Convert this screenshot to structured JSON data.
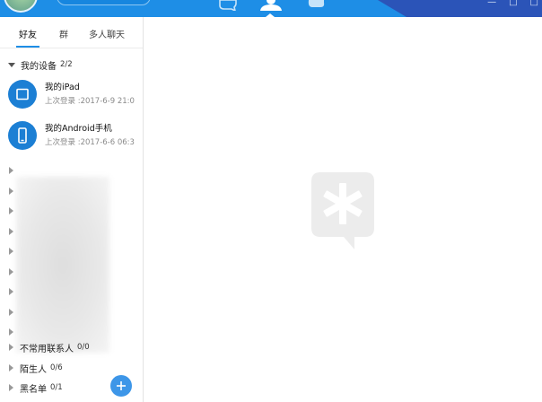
{
  "sidebar": {
    "tabs": [
      {
        "label": "好友"
      },
      {
        "label": "群"
      },
      {
        "label": "多人聊天"
      }
    ],
    "devices_group": {
      "name": "我的设备",
      "count": "2/2"
    },
    "devices": [
      {
        "name": "我的iPad",
        "subtitle": "上次登录 :2017-6-9 21:0",
        "icon": "tablet-icon"
      },
      {
        "name": "我的Android手机",
        "subtitle": "上次登录 :2017-6-6 06:3",
        "icon": "phone-icon"
      }
    ],
    "other_groups": [
      {
        "name": "不常用联系人",
        "count": "0/0"
      },
      {
        "name": "陌生人",
        "count": "0/6"
      },
      {
        "name": "黑名单",
        "count": "0/1"
      }
    ]
  },
  "colors": {
    "topbar": "#1e8ee6",
    "topbar_dark": "#2b54b8",
    "accent": "#1e8ee6",
    "device_icon": "#1c7fd4",
    "logo": "#ececec"
  },
  "icons": {
    "message_tab": "message-icon",
    "contacts_tab": "contacts-icon",
    "space_tab": "cloud-icon",
    "add": "plus-icon",
    "placeholder": "star-bubble-logo-icon"
  }
}
